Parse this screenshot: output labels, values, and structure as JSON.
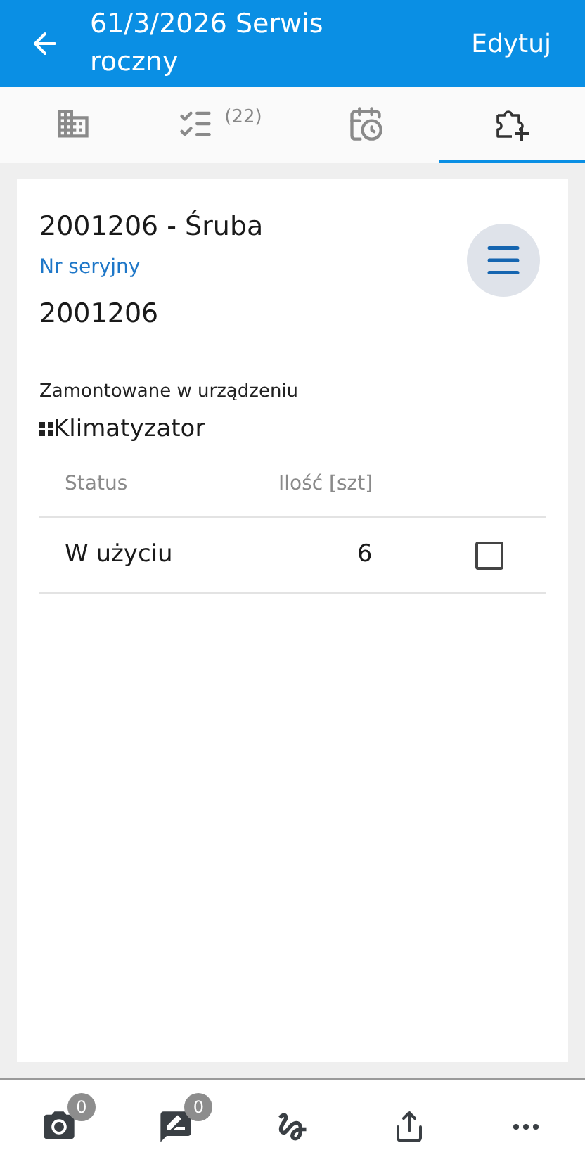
{
  "header": {
    "title": "61/3/2026 Serwis roczny",
    "action": "Edytuj"
  },
  "tabs": [
    {
      "selected": false
    },
    {
      "count": "(22)",
      "selected": false
    },
    {
      "selected": false
    },
    {
      "selected": true
    }
  ],
  "card": {
    "title": "2001206 - Śruba",
    "serial_label": "Nr seryjny",
    "serial_value": "2001206",
    "mounted_label": "Zamontowane w urządzeniu",
    "device": "Klimatyzator",
    "table": {
      "columns": [
        "Status",
        "Ilość [szt]"
      ],
      "rows": [
        {
          "status": "W użyciu",
          "quantity": "6",
          "checked": false
        }
      ]
    }
  },
  "toolbar": [
    {
      "kind": "camera",
      "badge": "0"
    },
    {
      "kind": "comment",
      "badge": "0"
    },
    {
      "kind": "signature"
    },
    {
      "kind": "share"
    },
    {
      "kind": "more"
    }
  ]
}
